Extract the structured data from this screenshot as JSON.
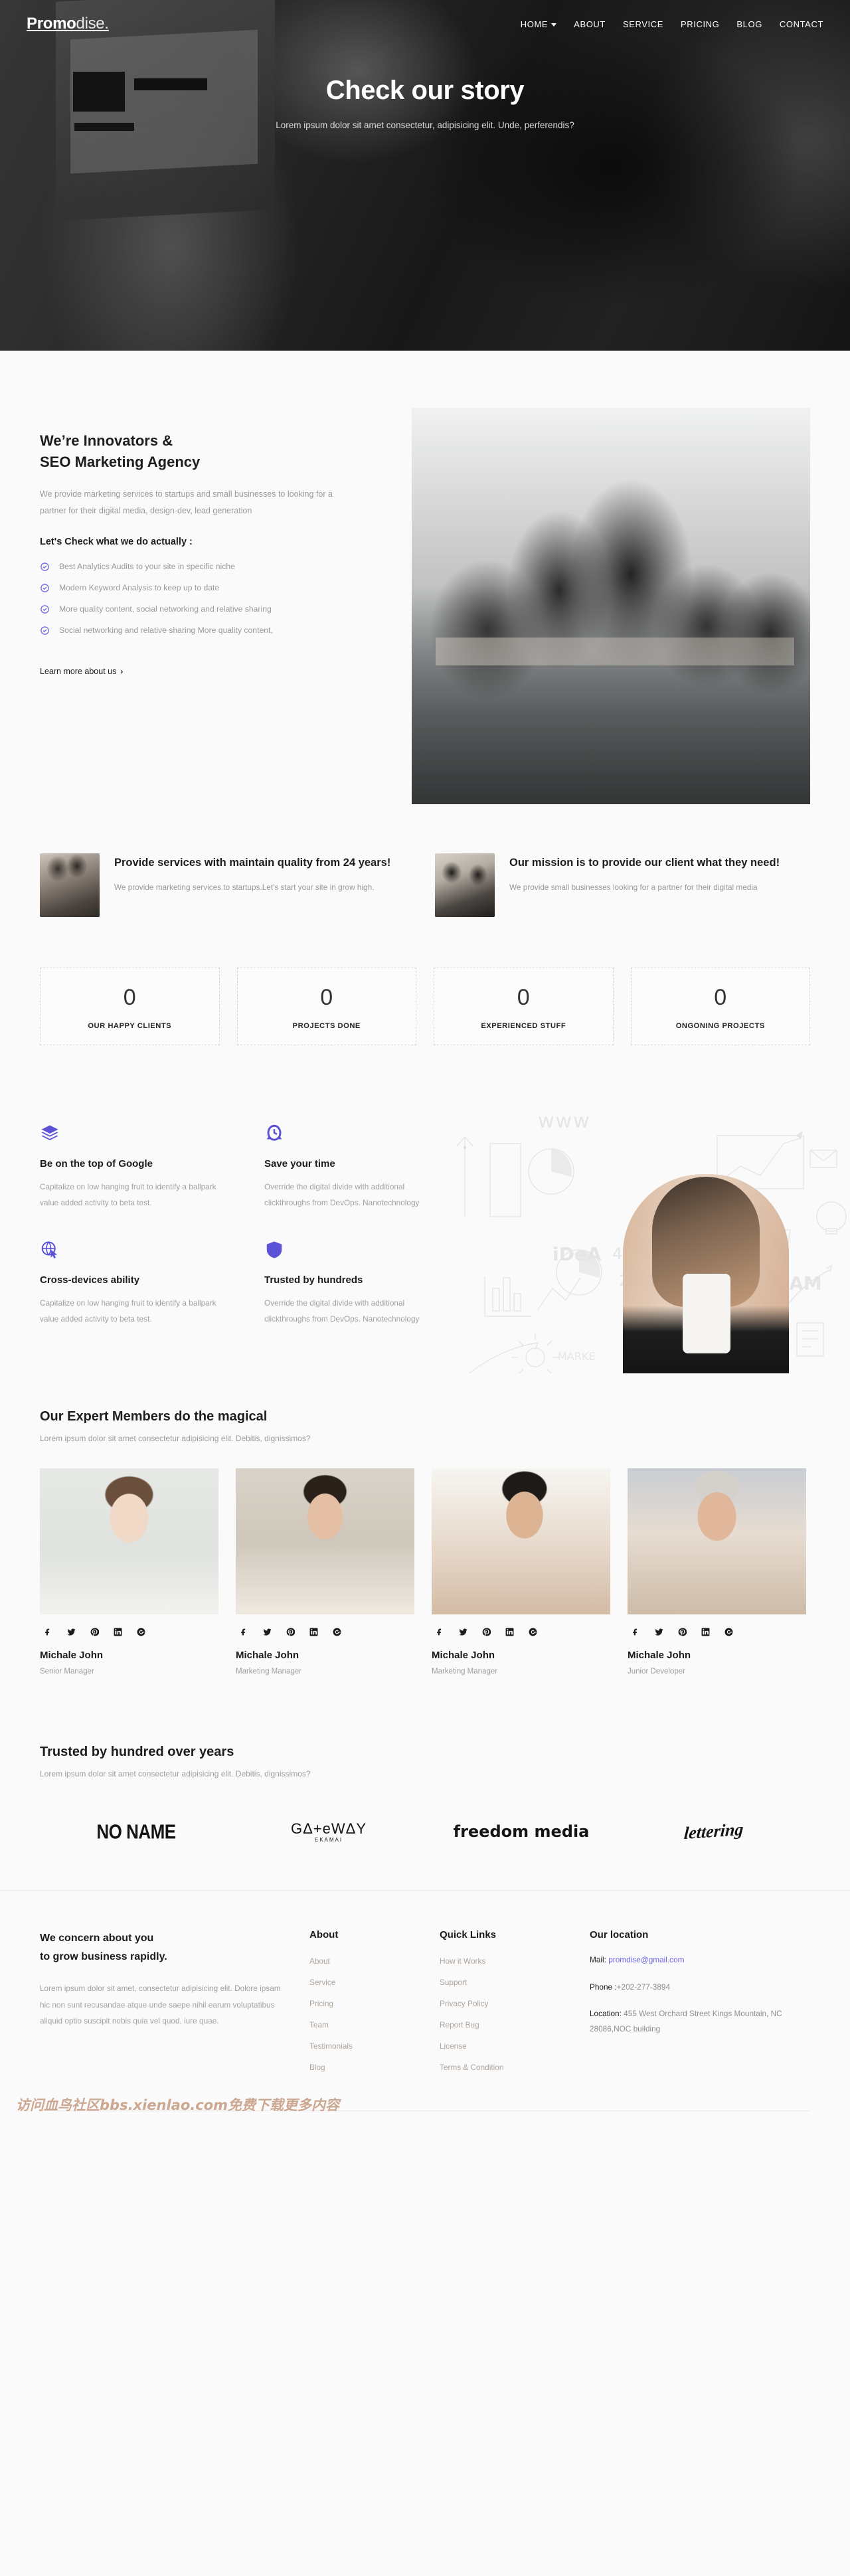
{
  "brand": {
    "bold": "Promo",
    "light": "dise."
  },
  "nav": [
    {
      "label": "HOME",
      "has_caret": true
    },
    {
      "label": "ABOUT",
      "has_caret": false
    },
    {
      "label": "SERVICE",
      "has_caret": false
    },
    {
      "label": "PRICING",
      "has_caret": false
    },
    {
      "label": "BLOG",
      "has_caret": false
    },
    {
      "label": "CONTACT",
      "has_caret": false
    }
  ],
  "hero": {
    "title": "Check our story",
    "subtitle": "Lorem ipsum dolor sit amet consectetur, adipisicing elit. Unde, perferendis?"
  },
  "about": {
    "heading_line1": "We’re Innovators &",
    "heading_line2": "SEO Marketing Agency",
    "paragraph": "We provide marketing services to startups and small businesses to looking for a partner for their digital media, design-dev, lead generation",
    "subheading": "Let's Check what we do actually :",
    "checks": [
      "Best Analytics Audits to your site in specific niche",
      "Modern Keyword Analysis to keep up to date",
      "More quality content, social networking and relative sharing",
      "Social networking and relative sharing More quality content,"
    ],
    "learn_more": "Learn more about us",
    "chevron": "›"
  },
  "services": [
    {
      "title": "Provide services with maintain quality from 24 years!",
      "text": "We provide marketing services to startups.Let's start your site in grow high."
    },
    {
      "title": "Our mission is to provide our client what they need!",
      "text": "We provide small businesses looking for a partner for their digital media"
    }
  ],
  "counters": [
    {
      "value": "0",
      "label": "OUR HAPPY CLIENTS"
    },
    {
      "value": "0",
      "label": "PROJECTS DONE"
    },
    {
      "value": "0",
      "label": "EXPERIENCED STUFF"
    },
    {
      "value": "0",
      "label": "ONGONING PROJECTS"
    }
  ],
  "features": [
    {
      "icon": "layers-icon",
      "title": "Be on the top of Google",
      "text": "Capitalize on low hanging fruit to identify a ballpark value added activity to beta test."
    },
    {
      "icon": "clock-icon",
      "title": "Save your time",
      "text": "Override the digital divide with additional clickthroughs from DevOps. Nanotechnology"
    },
    {
      "icon": "globe-cursor-icon",
      "title": "Cross-devices ability",
      "text": "Capitalize on low hanging fruit to identify a ballpark value added activity to beta test."
    },
    {
      "icon": "shield-icon",
      "title": "Trusted by hundreds",
      "text": "Override the digital divide with additional clickthroughs from DevOps. Nanotechnology"
    }
  ],
  "team_section": {
    "heading": "Our Expert Members do the magical",
    "sub": "Lorem ipsum dolor sit amet consectetur adipisicing elit. Debitis, dignissimos?",
    "social_icons": [
      "facebook-icon",
      "twitter-icon",
      "pinterest-icon",
      "linkedin-icon",
      "google-plus-icon"
    ],
    "members": [
      {
        "name": "Michale John",
        "role": "Senior Manager"
      },
      {
        "name": "Michale John",
        "role": "Marketing Manager"
      },
      {
        "name": "Michale John",
        "role": "Marketing Manager"
      },
      {
        "name": "Michale John",
        "role": "Junior Developer"
      }
    ]
  },
  "brands_section": {
    "heading": "Trusted by hundred over years",
    "sub": "Lorem ipsum dolor sit amet consectetur adipisicing elit. Debitis, dignissimos?",
    "logos": [
      {
        "name": "NO NAME",
        "sub": ""
      },
      {
        "name": "GΔ+eWΔY",
        "sub": "EKAMAI"
      },
      {
        "name": "freedom media",
        "sub": ""
      },
      {
        "name": "lettering",
        "sub": ""
      }
    ]
  },
  "footer": {
    "heading_line1": "We concern about you",
    "heading_line2": "to grow business rapidly.",
    "text": "Lorem ipsum dolor sit amet, consectetur adipisicing elit. Dolore ipsam hic non sunt recusandae atque unde saepe nihil earum voluptatibus aliquid optio suscipit nobis quia vel quod, iure quae.",
    "about": {
      "title": "About",
      "links": [
        "About",
        "Service",
        "Pricing",
        "Team",
        "Testimonials",
        "Blog"
      ]
    },
    "quick": {
      "title": "Quick Links",
      "links": [
        "How it Works",
        "Support",
        "Privacy Policy",
        "Report Bug",
        "License",
        "Terms & Condition"
      ]
    },
    "location": {
      "title": "Our location",
      "mail_label": "Mail:",
      "mail_value": "promdise@gmail.com",
      "phone_label": "Phone :",
      "phone_value": "+202-277-3894",
      "location_label": "Location:",
      "location_value": "455 West Orchard Street Kings Mountain, NC 28086,NOC building"
    }
  },
  "watermark": "访问血鸟社区bbs.xienlao.com免费下载更多内容",
  "colors": {
    "accent": "#5b52d6",
    "link": "#6b63e0",
    "muted": "#9a9a9a",
    "dark": "#1d1d1d"
  }
}
